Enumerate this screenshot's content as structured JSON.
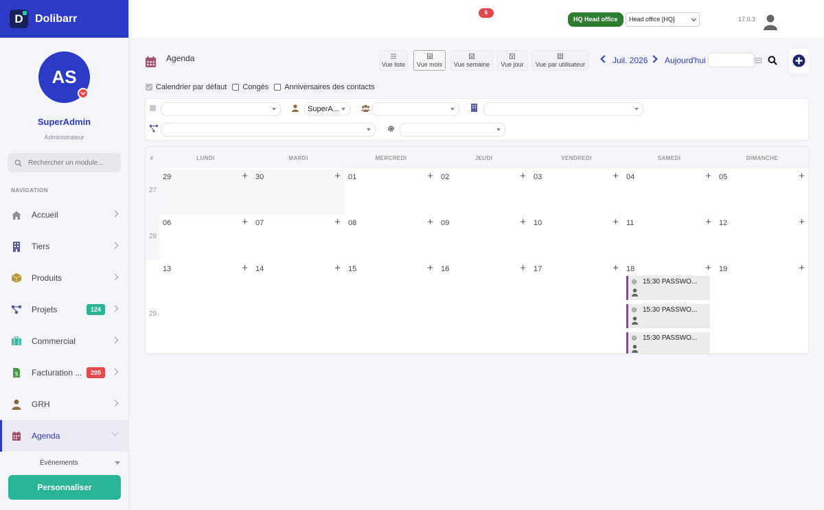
{
  "app": {
    "name": "Dolibarr",
    "version": "17.0.3"
  },
  "colors": {
    "brand": "#2b3ac7",
    "accent": "#2bb597",
    "danger": "#e5484d",
    "company": "#2e7d32",
    "event": "#7b4f8f"
  },
  "user": {
    "initials": "AS",
    "name": "SuperAdmin",
    "role": "Administrateur"
  },
  "search": {
    "placeholder": "Rechercher un module..."
  },
  "nav": {
    "title": "NAVIGATION",
    "items": [
      {
        "label": "Accueil",
        "icon": "home-icon"
      },
      {
        "label": "Tiers",
        "icon": "building-icon"
      },
      {
        "label": "Produits",
        "icon": "box-icon"
      },
      {
        "label": "Projets",
        "icon": "project-icon",
        "badge": "124"
      },
      {
        "label": "Commercial",
        "icon": "briefcase-icon"
      },
      {
        "label": "Facturation ...",
        "icon": "invoice-icon",
        "badge": "205"
      },
      {
        "label": "GRH",
        "icon": "person-icon"
      },
      {
        "label": "Agenda",
        "icon": "calendar-icon"
      }
    ],
    "sub_item": "Événements",
    "customize": "Personnaliser"
  },
  "topbar": {
    "notifications": "6",
    "company_badge": "HQ Head office",
    "company_select": "Head office [HQ]"
  },
  "page": {
    "title": "Agenda",
    "views": [
      "Vue liste",
      "Vue mois",
      "Vue semaine",
      "Vue jour",
      "Vue par utilisateur"
    ],
    "selected_view": "Vue mois",
    "month": "Juil. 2026",
    "today": "Aujourd'hui"
  },
  "checkboxes": [
    {
      "label": "Calendrier par défaut",
      "checked": true
    },
    {
      "label": "Congés",
      "checked": false
    },
    {
      "label": "Anniversaires des contacts",
      "checked": false
    }
  ],
  "filters": {
    "user_value": "SuperA..."
  },
  "calendar": {
    "week_header": "#",
    "days": [
      "LUNDI",
      "MARDI",
      "MERCREDI",
      "JEUDI",
      "VENDREDI",
      "SAMEDI",
      "DIMANCHE"
    ],
    "weeks": [
      {
        "num": "27",
        "dates": [
          "29",
          "30",
          "01",
          "02",
          "03",
          "04",
          "05"
        ]
      },
      {
        "num": "28",
        "dates": [
          "06",
          "07",
          "08",
          "09",
          "10",
          "11",
          "12"
        ]
      },
      {
        "num": "29",
        "dates": [
          "13",
          "14",
          "15",
          "16",
          "17",
          "18",
          "19"
        ]
      }
    ],
    "events": [
      {
        "text": "15:30 PASSWO..."
      },
      {
        "text": "15:30 PASSWO..."
      },
      {
        "text": "15:30 PASSWO..."
      }
    ]
  }
}
